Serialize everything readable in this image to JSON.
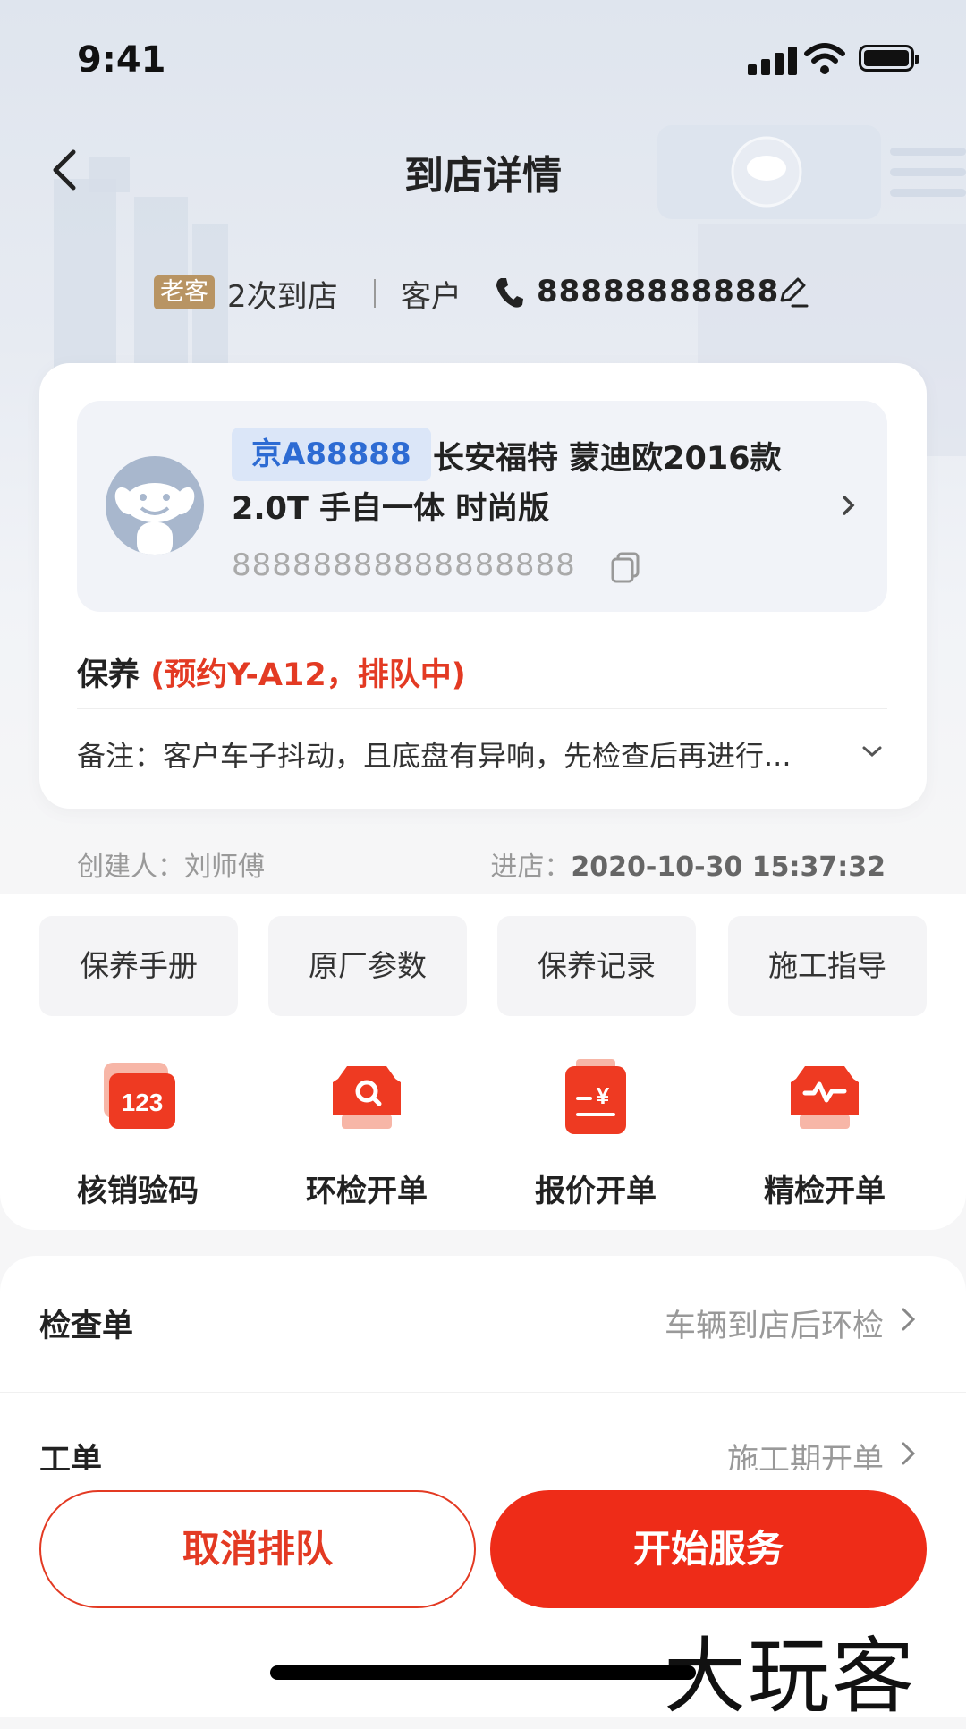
{
  "status_bar": {
    "time": "9:41"
  },
  "header": {
    "title": "到店详情"
  },
  "customer": {
    "tag": "老客",
    "visits": "2次到店",
    "name": "客户",
    "phone": "88888888888"
  },
  "vehicle": {
    "plate": "京A88888",
    "model_line1": "长安福特 蒙迪欧2016款",
    "model_line2": "2.0T 手自一体 时尚版",
    "vin": "88888888888888888"
  },
  "service": {
    "type": "保养",
    "status": "(预约Y-A12，排队中)",
    "note": "备注：客户车子抖动，且底盘有异响，先检查后再进行..."
  },
  "meta": {
    "creator_label": "创建人：",
    "creator": "刘师傅",
    "entry_label": "进店：",
    "entry_time": "2020-10-30 15:37:32"
  },
  "tools": [
    "保养手册",
    "原厂参数",
    "保养记录",
    "施工指导"
  ],
  "actions": [
    {
      "label": "核销验码",
      "icon": "verify-code-icon"
    },
    {
      "label": "环检开单",
      "icon": "car-inspection-icon"
    },
    {
      "label": "报价开单",
      "icon": "quote-order-icon"
    },
    {
      "label": "精检开单",
      "icon": "precision-inspection-icon"
    }
  ],
  "list": [
    {
      "label": "检查单",
      "value": "车辆到店后环检"
    },
    {
      "label": "工单",
      "value": "施工期开单"
    }
  ],
  "buttons": {
    "cancel": "取消排队",
    "start": "开始服务"
  },
  "watermark": "大玩客",
  "colors": {
    "accent": "#ee2c18",
    "plate_text": "#2d6bd3",
    "tag_bg": "#b89463"
  }
}
